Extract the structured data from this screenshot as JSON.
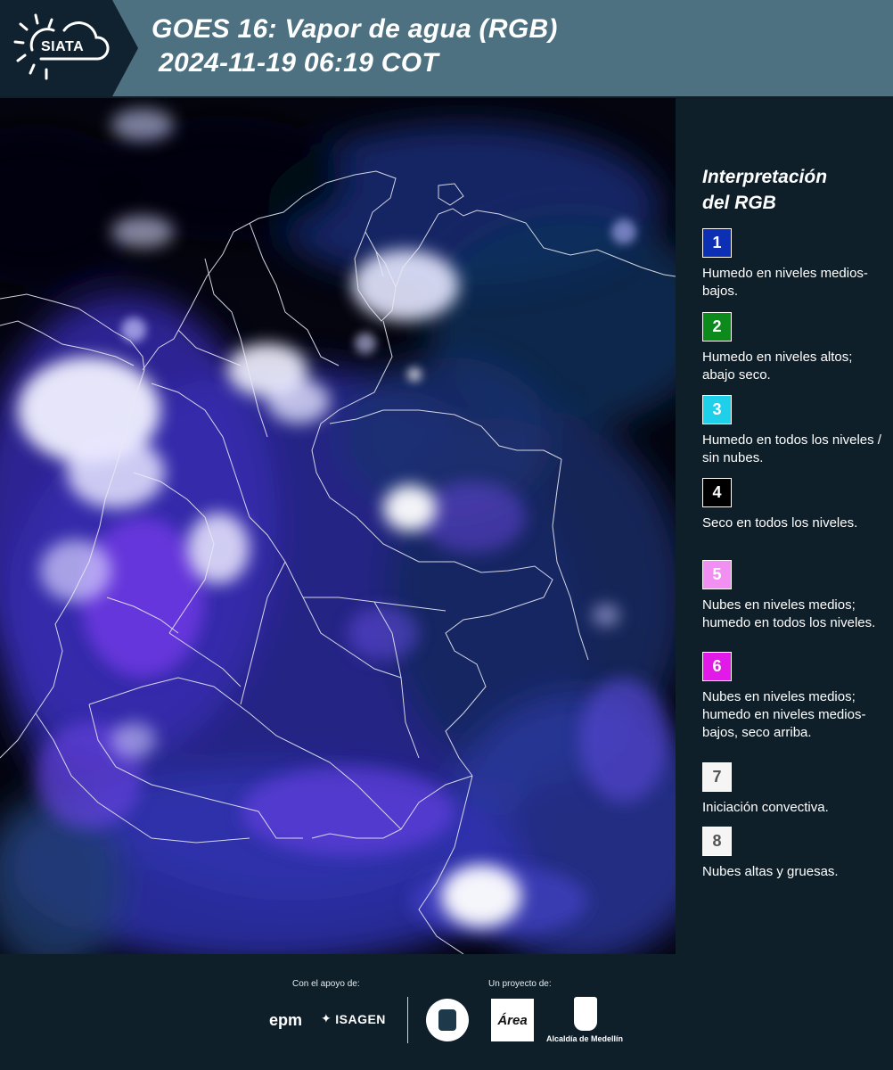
{
  "header": {
    "logo_text": "SIATA",
    "title_line1": "GOES 16: Vapor de agua (RGB)",
    "title_line2": "2024-11-19 06:19 COT",
    "band_color": "#4d7180",
    "logo_bg_color": "#102230"
  },
  "map": {
    "description_colors": {
      "background": "#03040e",
      "borders": "#e6e8f0"
    }
  },
  "legend": {
    "title_line1": "Interpretación",
    "title_line2": "del RGB",
    "items": [
      {
        "number": "1",
        "color": "#0d2fb4",
        "text_color": "#ffffff",
        "description": "Humedo en niveles medios-bajos."
      },
      {
        "number": "2",
        "color": "#0c8a1c",
        "text_color": "#ffffff",
        "description": "Humedo en niveles altos; abajo seco."
      },
      {
        "number": "3",
        "color": "#1fd0ea",
        "text_color": "#ffffff",
        "description": "Humedo en todos los niveles / sin nubes."
      },
      {
        "number": "4",
        "color": "#000000",
        "text_color": "#ffffff",
        "description": "Seco en todos los niveles."
      },
      {
        "number": "5",
        "color": "#f28ff2",
        "text_color": "#ffffff",
        "description": "Nubes en niveles medios; humedo en todos los niveles."
      },
      {
        "number": "6",
        "color": "#e21ae8",
        "text_color": "#ffffff",
        "description": "Nubes en niveles medios; humedo en niveles medios-bajos, seco arriba."
      },
      {
        "number": "7",
        "color": "#f5f5f5",
        "text_color": "#555555",
        "description": "Iniciación convectiva."
      },
      {
        "number": "8",
        "color": "#f5f5f5",
        "text_color": "#555555",
        "description": "Nubes altas y gruesas."
      }
    ]
  },
  "footer": {
    "support_label": "Con el apoyo de:",
    "project_label": "Un proyecto de:",
    "epm": "epm",
    "isagen": "ISAGEN",
    "area_metropolitana": "Área",
    "alcaldia": "Alcaldía de Medellín"
  }
}
